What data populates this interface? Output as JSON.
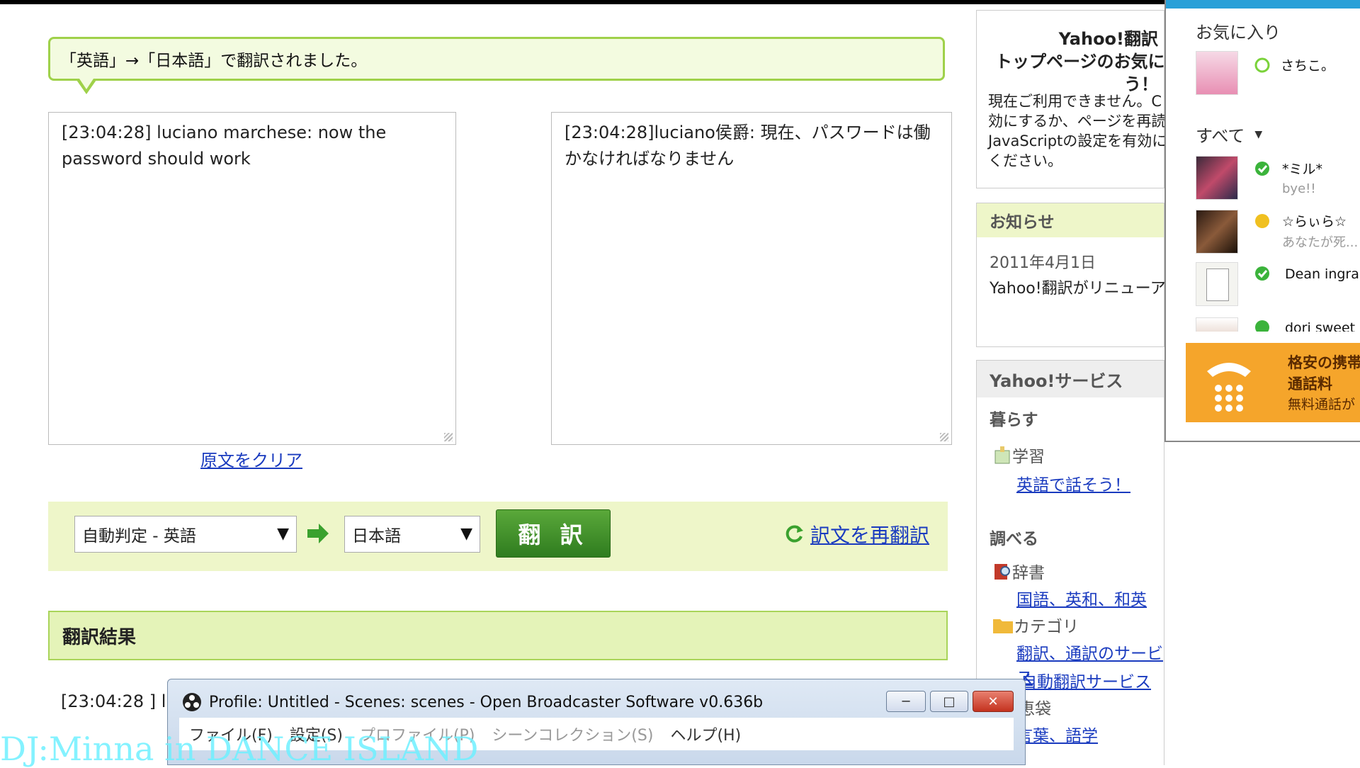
{
  "notice": {
    "text": "「英語」→「日本語」で翻訳されました。"
  },
  "source_box": {
    "text": "[23:04:28] luciano marchese: now the password should work"
  },
  "target_box": {
    "text": "[23:04:28]luciano侯爵: 現在、パスワードは働かなければなりません"
  },
  "clear_link": "原文をクリア",
  "controls": {
    "source_lang": "自動判定 - 英語",
    "target_lang": "日本語",
    "translate_button": "翻 訳",
    "retranslate_link": "訳文を再翻訳"
  },
  "result": {
    "header": "翻訳結果",
    "text": "[23:04:28 ] lu"
  },
  "right_column": {
    "promo_title_1": "Yahoo!翻訳",
    "promo_title_2": "トップページのお気に",
    "promo_title_3": "う！",
    "promo_body_1": "現在ご利用できません。C",
    "promo_body_2": "効にするか、ページを再読",
    "promo_body_3": "JavaScriptの設定を有効に",
    "promo_body_4": "ください。",
    "news_header": "お知らせ",
    "news_date": "2011年4月1日",
    "news_text": "Yahoo!翻訳がリニューア",
    "services_header": "Yahoo!サービス",
    "cat_live": "暮らす",
    "item_study": "学習",
    "link_english": "英語で話そう！",
    "cat_search": "調べる",
    "item_dict": "辞書",
    "link_dict": "国語、英和、和英",
    "item_category": "カテゴリ",
    "link_translate_service": "翻訳、通訳のサービス",
    "link_auto_translate": "自動翻訳サービス",
    "item_chie": "知恵袋",
    "link_chie": "言葉、語学"
  },
  "buddy_list": {
    "favorites_header": "お気に入り",
    "all_header": "すべて",
    "buddies": [
      {
        "name": "さちこ。",
        "status": ""
      },
      {
        "name": "*ミル*",
        "status": "bye!!"
      },
      {
        "name": "☆らぃら☆",
        "status": "あなたが死..."
      },
      {
        "name": "Dean ingram",
        "status": ""
      },
      {
        "name": "dori sweet",
        "status": ""
      }
    ],
    "ad_line1": "格安の携帯",
    "ad_line2": "通話料",
    "ad_line3": "無料通話が"
  },
  "obs": {
    "title": "Profile: Untitled - Scenes: scenes - Open Broadcaster Software v0.636b",
    "menu": [
      "ファイル(F)",
      "設定(S)",
      "プロファイル(P)",
      "シーンコレクション(S)",
      "ヘルプ(H)"
    ],
    "btn_min": "─",
    "btn_max": "□",
    "btn_close": "✕"
  },
  "watermark": "DJ:Minna in DANCE ISLAND",
  "colors": {
    "accent_green": "#9fd14a",
    "button_green": "#3f8f2a",
    "link_blue": "#1a3bbf",
    "ad_orange": "#f5a52b"
  }
}
